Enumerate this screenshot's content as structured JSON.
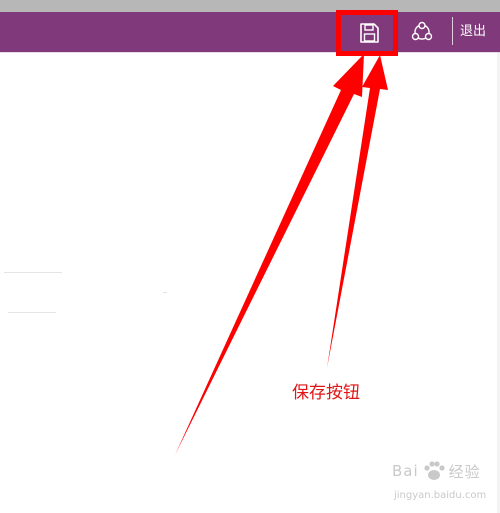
{
  "toolbar": {
    "save_icon": "save-disk-icon",
    "share_icon": "share-icon",
    "exit_label": "退出"
  },
  "annotation": {
    "label": "保存按钮"
  },
  "watermark": {
    "left_text": "Bai",
    "right_text": "经验",
    "url": "jingyan.baidu.com"
  },
  "colors": {
    "app_bar": "#80397b",
    "highlight": "#ff0000",
    "annotation_text": "#e01515"
  }
}
